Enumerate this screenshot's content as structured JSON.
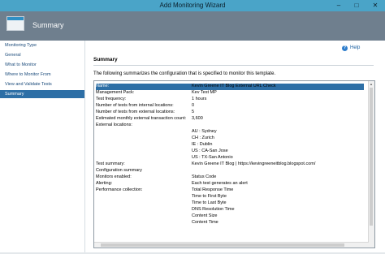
{
  "window": {
    "title": "Add Monitoring Wizard",
    "minimize_label": "–",
    "maximize_label": "□",
    "close_label": "✕"
  },
  "header": {
    "title": "Summary",
    "icon": "wizard-page-icon"
  },
  "sidebar": {
    "items": [
      {
        "label": "Monitoring Type",
        "active": false
      },
      {
        "label": "General",
        "active": false
      },
      {
        "label": "What to Monitor",
        "active": false
      },
      {
        "label": "Where to Monitor From",
        "active": false
      },
      {
        "label": "View and Validate Tests",
        "active": false
      },
      {
        "label": "Summary",
        "active": true
      }
    ],
    "active_color": "#2d6fa6"
  },
  "main": {
    "help_label": "Help",
    "section_title": "Summary",
    "description": "The following summarizes the configuration that is specified to monitor this template.",
    "summary_rows": [
      {
        "label": "Name:",
        "value": "Kevin Greene IT Blog External URL Check"
      },
      {
        "label": "Management Pack:",
        "value": "Kev Test MP"
      },
      {
        "label": "Test frequency:",
        "value": "1 hours"
      },
      {
        "label": "Number of tests from internal locations:",
        "value": "0"
      },
      {
        "label": "Number of tests from external locations:",
        "value": "5"
      },
      {
        "label": "Estimated monthly external transaction count:",
        "value": "3,600"
      },
      {
        "label": "External locations:",
        "value": ""
      },
      {
        "label": "",
        "value": "AU : Sydney"
      },
      {
        "label": "",
        "value": "CH : Zurich"
      },
      {
        "label": "",
        "value": "IE : Dublin"
      },
      {
        "label": "",
        "value": "US : CA-San Jose"
      },
      {
        "label": "",
        "value": "US : TX-San Antonio"
      },
      {
        "label": "Test summary:",
        "value": "Kevin Greene IT Blog | https://kevingreeneitblog.blogspot.com/"
      },
      {
        "label": "Configuration summary",
        "value": ""
      },
      {
        "label": "Monitors enabled:",
        "value": "Status Code"
      },
      {
        "label": "Alerting:",
        "value": "Each test generates an alert"
      },
      {
        "label": "Performance collection:",
        "value": "Total Response Time"
      },
      {
        "label": "",
        "value": "Time to First Byte"
      },
      {
        "label": "",
        "value": "Time to Last Byte"
      },
      {
        "label": "",
        "value": "DNS Resolution Time"
      },
      {
        "label": "",
        "value": "Content Size"
      },
      {
        "label": "",
        "value": "Content Time"
      }
    ]
  },
  "colors": {
    "titlebar": "#4aa4c8",
    "header": "#6f7f8e",
    "selection": "#2d6fa6"
  }
}
